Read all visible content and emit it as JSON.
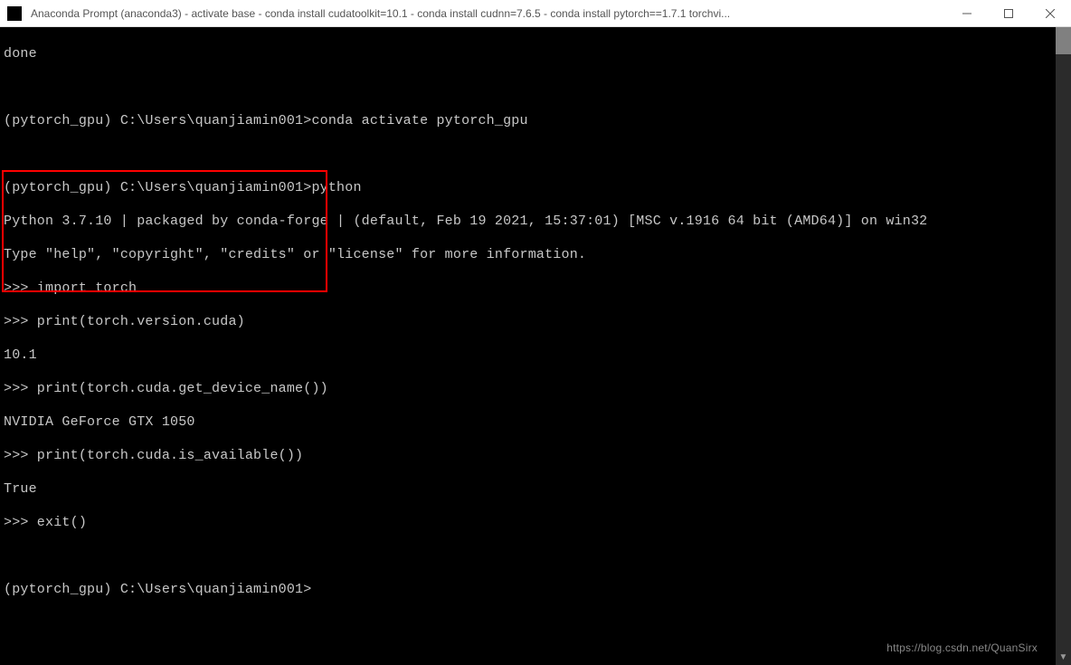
{
  "window": {
    "title": "Anaconda Prompt (anaconda3) - activate  base - conda  install cudatoolkit=10.1 - conda  install cudnn=7.6.5 - conda  install pytorch==1.7.1 torchvi..."
  },
  "terminal": {
    "lines": {
      "l0": "done",
      "l1": "",
      "l2": "(pytorch_gpu) C:\\Users\\quanjiamin001>conda activate pytorch_gpu",
      "l3": "",
      "l4": "(pytorch_gpu) C:\\Users\\quanjiamin001>python",
      "l5": "Python 3.7.10 | packaged by conda-forge | (default, Feb 19 2021, 15:37:01) [MSC v.1916 64 bit (AMD64)] on win32",
      "l6": "Type \"help\", \"copyright\", \"credits\" or \"license\" for more information.",
      "l7": ">>> import torch",
      "l8": ">>> print(torch.version.cuda)",
      "l9": "10.1",
      "l10": ">>> print(torch.cuda.get_device_name())",
      "l11": "NVIDIA GeForce GTX 1050",
      "l12": ">>> print(torch.cuda.is_available())",
      "l13": "True",
      "l14": ">>> exit()",
      "l15": "",
      "l16": "(pytorch_gpu) C:\\Users\\quanjiamin001>"
    }
  },
  "watermark": "https://blog.csdn.net/QuanSirx"
}
